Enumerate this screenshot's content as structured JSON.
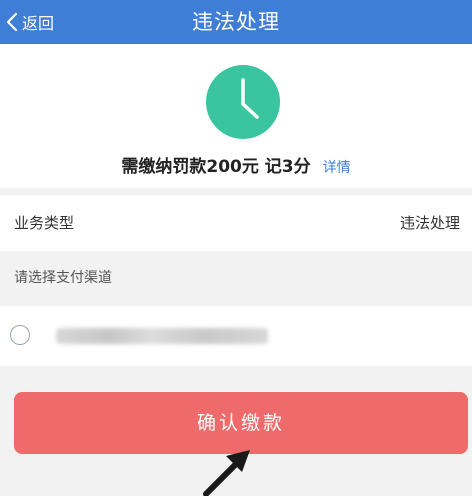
{
  "header": {
    "back_label": "返回",
    "title": "违法处理"
  },
  "summary": {
    "icon": "clock-icon",
    "fine_text": "需缴纳罚款200元 记3分",
    "detail_link": "详情"
  },
  "business": {
    "label": "业务类型",
    "value": "违法处理"
  },
  "payment": {
    "prompt": "请选择支付渠道"
  },
  "confirm_button": "确认缴款",
  "colors": {
    "header": "#3f7ed6",
    "clock": "#3bc4a0",
    "button": "#ef6b6b",
    "link": "#3f7ed6"
  }
}
